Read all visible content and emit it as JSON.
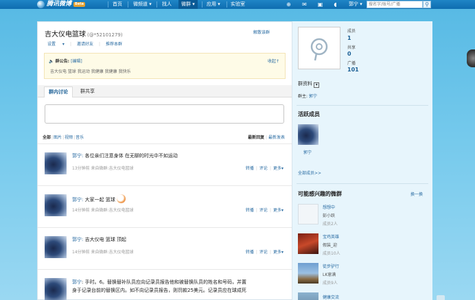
{
  "topbar": {
    "logo_text": "腾讯微博",
    "beta": "Beta",
    "nav": [
      "首页",
      "微频道",
      "找人",
      "微群",
      "应用",
      "实验室"
    ],
    "user": "郭宁",
    "search_placeholder": "搜名字/账号/广播"
  },
  "group": {
    "name": "吉大仪电篮球",
    "qq": "(@*52101279)",
    "dissolve": "解散该群",
    "links": [
      "设置",
      "邀请好友",
      "推荐本群"
    ],
    "notice_title": "群公告:",
    "notice_edit": "[编辑]",
    "notice_collapse": "收起↑",
    "notice_text": "吉大仪电 篮球 我运动 我健康 我健康 我快乐"
  },
  "tabs": [
    "群内讨论",
    "群共享"
  ],
  "filter": {
    "all": "全部",
    "items": [
      "图片",
      "视频",
      "音乐"
    ],
    "sort_active": "最新回复",
    "sort_other": "最新发表"
  },
  "posts": [
    {
      "author": "郭宁",
      "text": "各位亲们注意身体 在无聊的时光中不如运动",
      "meta": "13分钟前  来自微群:吉大仪电篮球",
      "actions": [
        "转播",
        "评论",
        "更多"
      ]
    },
    {
      "author": "郭宁",
      "text": "大家一起 篮球",
      "meta": "14分钟前  来自微群:吉大仪电篮球",
      "actions": [
        "转播",
        "评论",
        "更多"
      ]
    },
    {
      "author": "郭宁",
      "text": "吉大仪电 篮球 顶起",
      "meta": "14分钟前  来自微群:吉大仪电篮球",
      "actions": [
        "转播",
        "评论",
        "更多"
      ]
    },
    {
      "author": "郭宁",
      "text": "手时。6。替换替补队员应向记录员报告他和被替换队员的姓名和号码，并置",
      "text2": "身于记录台前的替换区内。如不向记录员报告，则罚款25美元。记录员应在球成死",
      "meta": "",
      "actions": []
    }
  ],
  "side": {
    "stats": [
      {
        "label": "成员",
        "value": "1"
      },
      {
        "label": "共享",
        "value": "0"
      },
      {
        "label": "广播",
        "value": "101"
      }
    ],
    "info_title": "群资料",
    "owner_label": "群主:",
    "owner_name": "郭宁",
    "active_title": "活跃成员",
    "active_member": "郭宁",
    "all_members": "全部成员>>",
    "rec_title": "可能感兴趣的微群",
    "rec_change": "换一换",
    "rec": [
      {
        "name": "想想中",
        "sub": "彭小跃",
        "count": "成员2人"
      },
      {
        "name": "宝鸡英雄",
        "sub": "假装_迎",
        "count": "成员10人"
      },
      {
        "name": "徒步驴行",
        "sub": "LK崽满",
        "count": "成员9人"
      },
      {
        "name": "健康交流",
        "sub": "",
        "count": ""
      }
    ]
  }
}
